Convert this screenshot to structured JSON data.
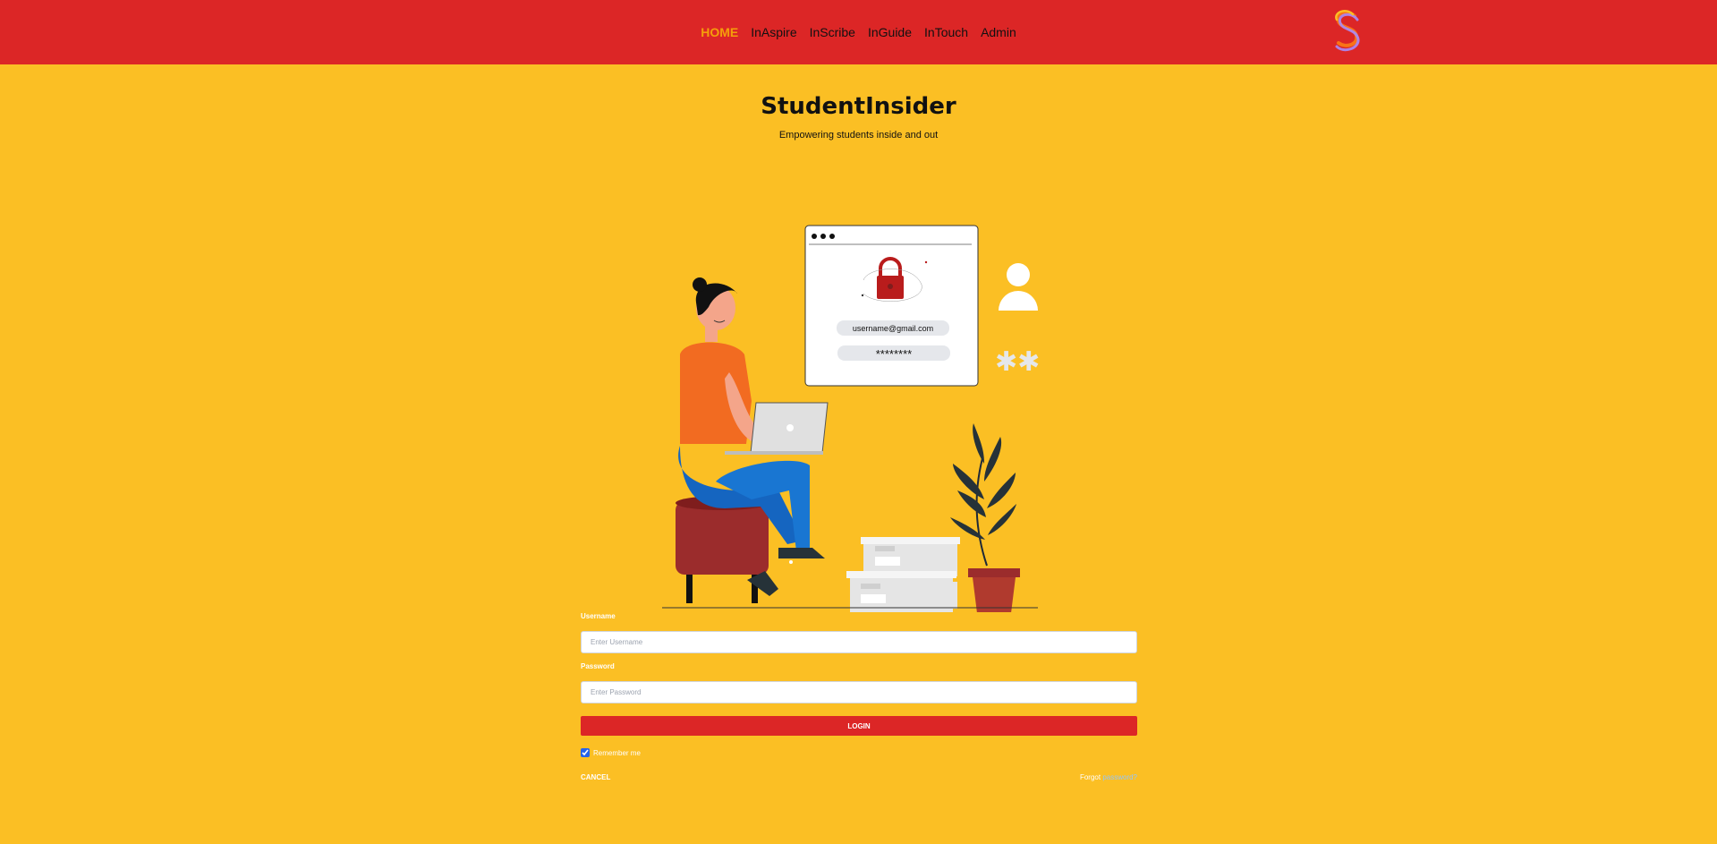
{
  "nav": {
    "items": [
      {
        "label": "HOME",
        "active": true
      },
      {
        "label": "InAspire",
        "active": false
      },
      {
        "label": "InScribe",
        "active": false
      },
      {
        "label": "InGuide",
        "active": false
      },
      {
        "label": "InTouch",
        "active": false
      },
      {
        "label": "Admin",
        "active": false
      }
    ]
  },
  "hero": {
    "title": "StudentInsider",
    "subtitle": "Empowering students inside and out"
  },
  "illustration": {
    "email": "username@gmail.com",
    "password_mask": "********"
  },
  "form": {
    "username_label": "Username",
    "username_placeholder": "Enter Username",
    "password_label": "Password",
    "password_placeholder": "Enter Password",
    "login_label": "LOGIN",
    "remember_label": "Remember me",
    "remember_checked": true,
    "cancel_label": "CANCEL",
    "forgot_prefix": "Forgot",
    "forgot_link": "password?"
  },
  "colors": {
    "navbar": "#dc2626",
    "background": "#fbbf24",
    "active_nav": "#f59e0b",
    "button": "#dc2626"
  }
}
